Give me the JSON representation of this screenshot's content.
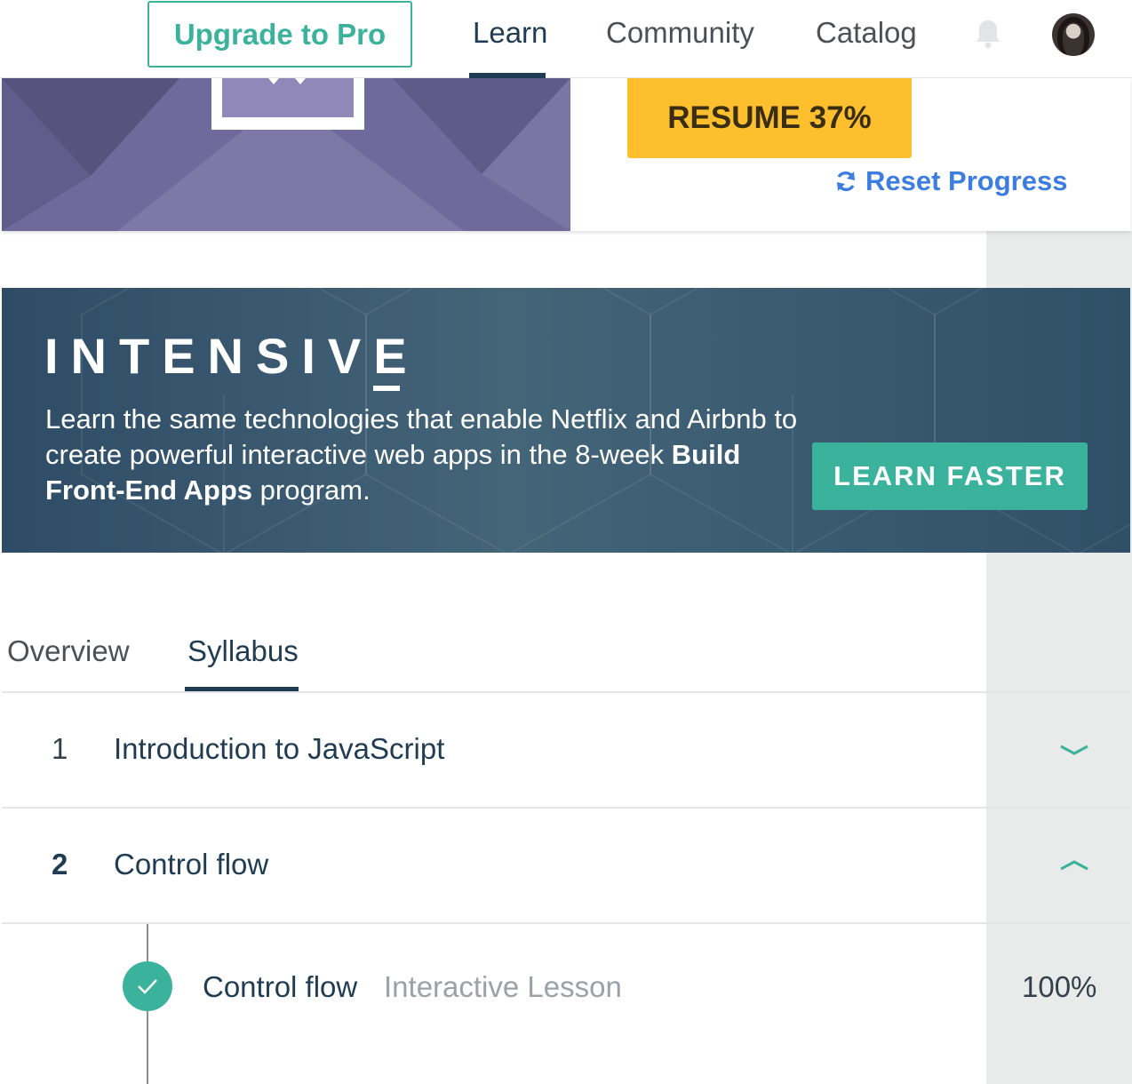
{
  "nav": {
    "upgrade_label": "Upgrade to Pro",
    "links": [
      "Learn",
      "Community",
      "Catalog"
    ],
    "active": "Learn",
    "bell_icon": "bell-icon",
    "avatar_icon": "user-avatar"
  },
  "hero": {
    "resume_label": "RESUME 37%",
    "progress_percent": 37,
    "reset_label": "Reset Progress",
    "reset_icon": "refresh-icon"
  },
  "banner": {
    "logo": "INTENSIVE",
    "text_intro": "Learn the same technologies that enable Netflix and Airbnb to create powerful interactive web apps in the 8-week ",
    "text_bold": "Build Front-End Apps",
    "text_end": " program.",
    "cta_label": "LEARN FASTER"
  },
  "tabs": {
    "items": [
      "Overview",
      "Syllabus"
    ],
    "active": "Syllabus"
  },
  "syllabus": {
    "units": [
      {
        "number": "1",
        "title": "Introduction to JavaScript",
        "expanded": false
      },
      {
        "number": "2",
        "title": "Control flow",
        "expanded": true
      }
    ],
    "lessons": [
      {
        "title": "Control flow",
        "type": "Interactive Lesson",
        "progress": "100%",
        "complete": true
      }
    ]
  },
  "colors": {
    "accent": "#3bb39c",
    "navy": "#1f3c52",
    "resume": "#fdbf2d",
    "link": "#3d7de0"
  }
}
